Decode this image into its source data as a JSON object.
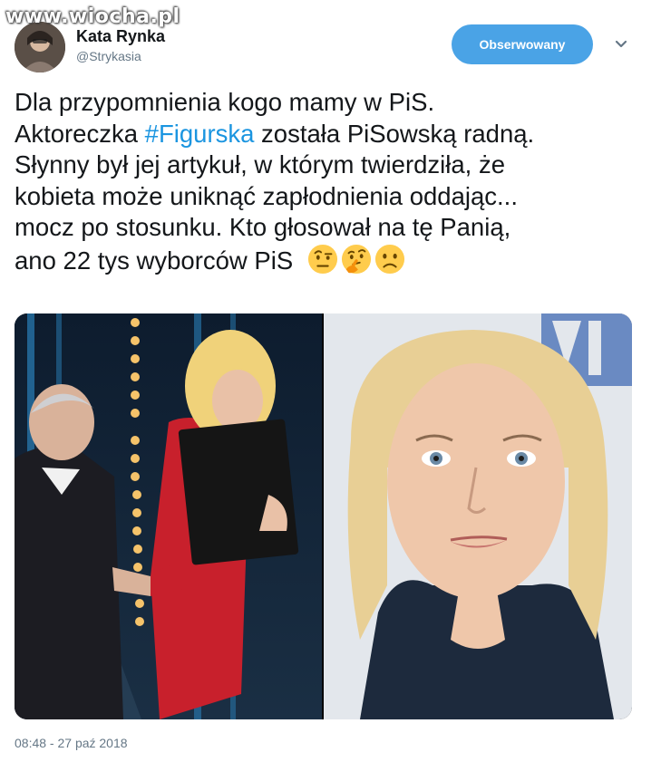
{
  "watermark": "www.wiocha.pl",
  "user": {
    "display_name": "Kata Rynka",
    "handle": "@Strykasia",
    "follow_label": "Obserwowany"
  },
  "tweet": {
    "line1": "Dla przypomnienia kogo mamy w PiS.",
    "line2_prefix": "Aktoreczka ",
    "hashtag": "#Figurska",
    "line2_suffix": " została PiSowską radną.",
    "line3": "Słynny był jej artykuł, w którym twierdziła, że",
    "line4": "kobieta może uniknąć zapłodnienia oddając...",
    "line5": "mocz po stosunku. Kto głosował na tę Panią,",
    "line6": "ano 22 tys wyborców PiS",
    "emojis": [
      "face-with-raised-eyebrow",
      "thinking-face",
      "slightly-frowning-face"
    ]
  },
  "media": {
    "photos": [
      "stage-handshake-photo",
      "portrait-photo"
    ]
  },
  "timestamp": "08:48 - 27 paź 2018",
  "colors": {
    "follow_button": "#4aa3e6",
    "hashtag": "#1b95e0",
    "secondary_text": "#657786",
    "text": "#14171a"
  }
}
